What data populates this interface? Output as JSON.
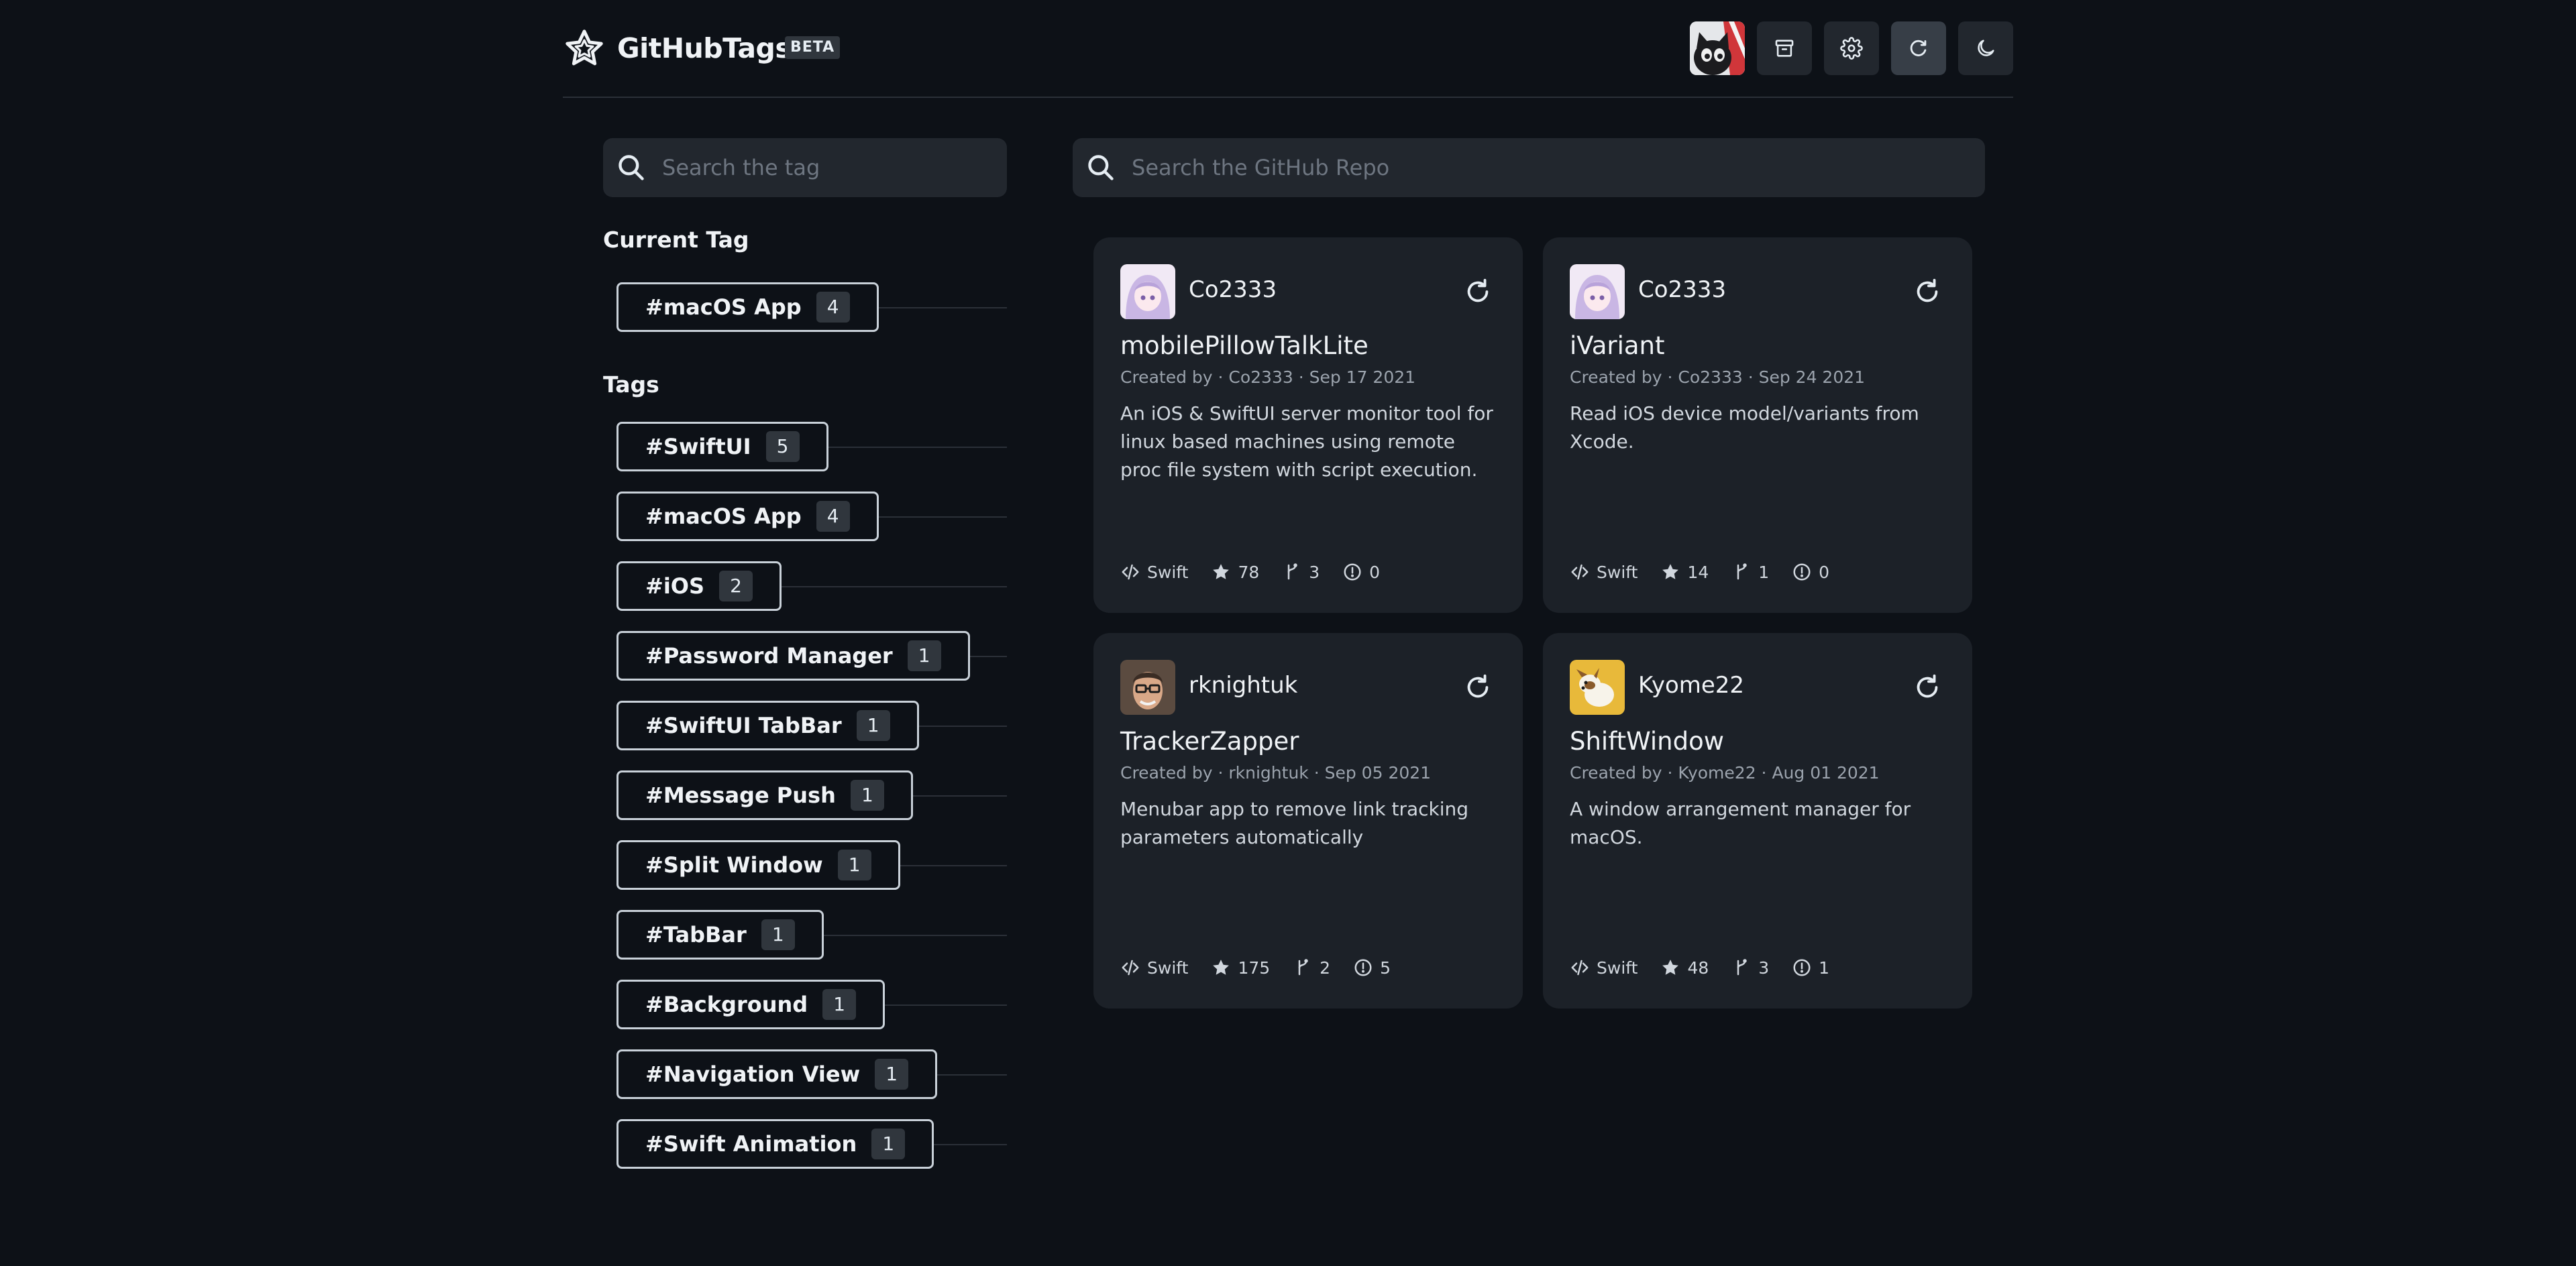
{
  "app": {
    "brand": "GitHubTags",
    "badge": "BETA"
  },
  "header_buttons": [
    "avatar",
    "archive-icon",
    "gear-icon",
    "reload-icon",
    "moon-icon"
  ],
  "tag_search": {
    "placeholder": "Search the tag"
  },
  "repo_search": {
    "placeholder": "Search the GitHub Repo"
  },
  "current_tag": {
    "title": "Current Tag",
    "tag": {
      "name": "#macOS App",
      "count": "4"
    }
  },
  "tags": {
    "title": "Tags",
    "items": [
      {
        "name": "#SwiftUI",
        "count": "5"
      },
      {
        "name": "#macOS App",
        "count": "4"
      },
      {
        "name": "#iOS",
        "count": "2"
      },
      {
        "name": "#Password Manager",
        "count": "1"
      },
      {
        "name": "#SwiftUI TabBar",
        "count": "1"
      },
      {
        "name": "#Message Push",
        "count": "1"
      },
      {
        "name": "#Split Window",
        "count": "1"
      },
      {
        "name": "#TabBar",
        "count": "1"
      },
      {
        "name": "#Background",
        "count": "1"
      },
      {
        "name": "#Navigation View",
        "count": "1"
      },
      {
        "name": "#Swift Animation",
        "count": "1"
      }
    ]
  },
  "repos": [
    {
      "owner": "Co2333",
      "name": "mobilePillowTalkLite",
      "meta": "Created by · Co2333 · Sep 17 2021",
      "description": "An iOS & SwiftUI server monitor tool for linux based machines using remote proc file system with script execution.",
      "language": "Swift",
      "stars": "78",
      "forks": "3",
      "issues": "0",
      "avatar_color": "#e9def0"
    },
    {
      "owner": "Co2333",
      "name": "iVariant",
      "meta": "Created by · Co2333 · Sep 24 2021",
      "description": "Read iOS device model/variants from Xcode.",
      "language": "Swift",
      "stars": "14",
      "forks": "1",
      "issues": "0",
      "avatar_color": "#e9def0"
    },
    {
      "owner": "rknightuk",
      "name": "TrackerZapper",
      "meta": "Created by · rknightuk · Sep 05 2021",
      "description": "Menubar app to remove link tracking parameters automatically",
      "language": "Swift",
      "stars": "175",
      "forks": "2",
      "issues": "5",
      "avatar_color": "#6b5a4e"
    },
    {
      "owner": "Kyome22",
      "name": "ShiftWindow",
      "meta": "Created by · Kyome22 · Aug 01 2021",
      "description": "A window arrangement manager for macOS.",
      "language": "Swift",
      "stars": "48",
      "forks": "3",
      "issues": "1",
      "avatar_color": "#e8b93a"
    }
  ]
}
